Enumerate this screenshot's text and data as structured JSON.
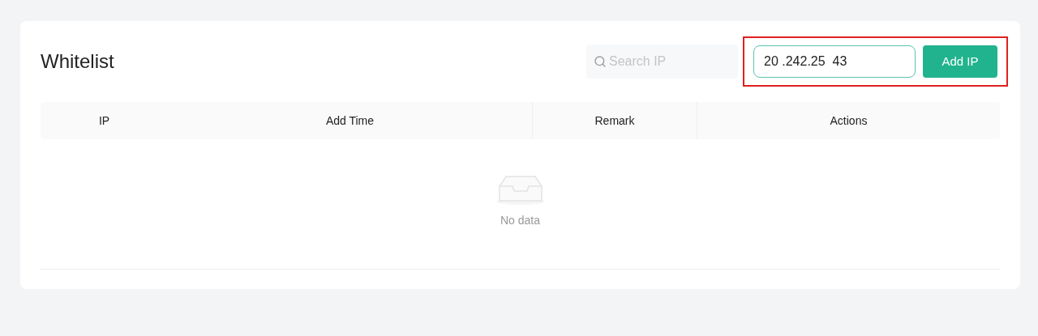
{
  "title": "Whitelist",
  "search": {
    "placeholder": "Search IP"
  },
  "ip_input": {
    "value": "20 .242.25  43"
  },
  "add_button": {
    "label": "Add IP"
  },
  "table": {
    "columns": [
      "IP",
      "Add Time",
      "Remark",
      "Actions"
    ],
    "empty_text": "No data"
  }
}
